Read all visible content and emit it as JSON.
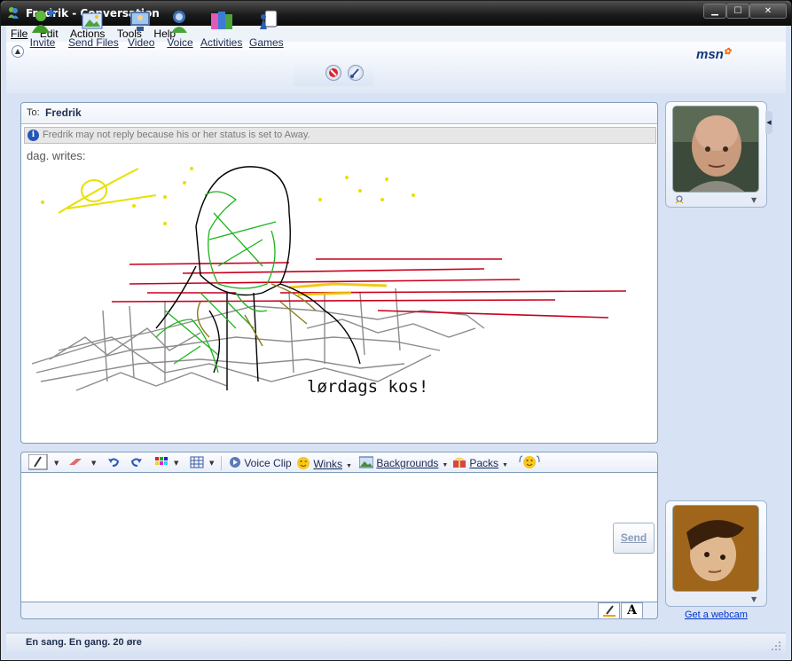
{
  "window": {
    "title": "Fredrik - Conversation",
    "buttons": {
      "minimize": "▁",
      "maximize": "☐",
      "close": "✕"
    }
  },
  "menu": [
    "File",
    "Edit",
    "Actions",
    "Tools",
    "Help"
  ],
  "toolbar": {
    "items": [
      {
        "label": "Invite",
        "icon": "invite-icon"
      },
      {
        "label": "Send Files",
        "icon": "send-files-icon"
      },
      {
        "label": "Video",
        "icon": "video-icon"
      },
      {
        "label": "Voice",
        "icon": "voice-icon"
      },
      {
        "label": "Activities",
        "icon": "activities-icon"
      },
      {
        "label": "Games",
        "icon": "games-icon"
      }
    ],
    "brand": "msn"
  },
  "conversation": {
    "to_label": "To:",
    "to_name": "Fredrik",
    "notice": "Fredrik may not reply because his or her status is set to Away.",
    "writes": "dag. writes:",
    "handwriting": "lørdags kos!"
  },
  "compose_toolbar": {
    "voice_clip": "Voice Clip",
    "winks": "Winks",
    "backgrounds": "Backgrounds",
    "packs": "Packs"
  },
  "compose": {
    "send_label": "Send"
  },
  "sidebar": {
    "webcam_link": "Get a webcam"
  },
  "status": {
    "text": "En sang. En gang. 20 øre"
  },
  "colors": {
    "accent": "#13387a",
    "link": "#0033cc",
    "ink_green": "#1db31d",
    "ink_red": "#c8001e",
    "ink_yellow": "#e8e000"
  }
}
